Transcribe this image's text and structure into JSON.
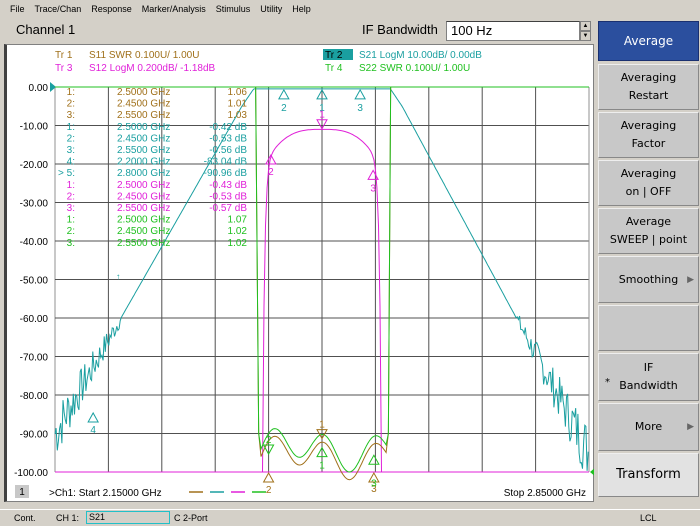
{
  "menu": [
    "File",
    "Trace/Chan",
    "Response",
    "Marker/Analysis",
    "Stimulus",
    "Utility",
    "Help"
  ],
  "channel_title": "Channel 1",
  "if_bandwidth": {
    "label": "IF Bandwidth",
    "value": "100 Hz"
  },
  "softkeys": [
    {
      "label1": "Average",
      "label2": "",
      "active": true
    },
    {
      "label1": "Averaging",
      "label2": "Restart"
    },
    {
      "label1": "Averaging",
      "label2": "Factor"
    },
    {
      "label1": "Averaging",
      "label2": "on | OFF"
    },
    {
      "label1": "Average",
      "label2": "SWEEP | point"
    },
    {
      "label1": "Smoothing",
      "label2": "",
      "submenu": true
    },
    {
      "label1": "",
      "label2": ""
    },
    {
      "label1": "IF",
      "label2": "Bandwidth",
      "star": "*"
    },
    {
      "label1": "More",
      "label2": "",
      "submenu": true
    },
    {
      "label1": "Transform",
      "label2": ""
    }
  ],
  "traces": {
    "tr1": {
      "id": "Tr  1",
      "desc": "S11 SWR 0.100U/  1.00U",
      "color": "#a0701a"
    },
    "tr2": {
      "id": "Tr  2",
      "desc": "S21 LogM 10.00dB/  0.00dB",
      "color": "#1a9fa0",
      "highlight": "#1a9fa0"
    },
    "tr3": {
      "id": "Tr  3",
      "desc": "S12 LogM 0.200dB/  -1.18dB",
      "color": "#e020d8"
    },
    "tr4": {
      "id": "Tr  4",
      "desc": "S22 SWR 0.100U/  1.00U",
      "color": "#20c020"
    }
  },
  "marker_table": [
    {
      "num": "1:",
      "freq": "2.5000 GHz",
      "val": "1.06",
      "trace": "tr1"
    },
    {
      "num": "2:",
      "freq": "2.4500 GHz",
      "val": "1.01",
      "trace": "tr1"
    },
    {
      "num": "3:",
      "freq": "2.5500 GHz",
      "val": "1.03",
      "trace": "tr1"
    },
    {
      "num": "1:",
      "freq": "2.5000 GHz",
      "val": "-0.42 dB",
      "trace": "tr2"
    },
    {
      "num": "2:",
      "freq": "2.4500 GHz",
      "val": "-0.53 dB",
      "trace": "tr2"
    },
    {
      "num": "3:",
      "freq": "2.5500 GHz",
      "val": "-0.56 dB",
      "trace": "tr2"
    },
    {
      "num": "4:",
      "freq": "2.2000 GHz",
      "val": "-83.04 dB",
      "trace": "tr2"
    },
    {
      "num": "> 5:",
      "freq": "2.8000 GHz",
      "val": "-90.96 dB",
      "trace": "tr2"
    },
    {
      "num": "1:",
      "freq": "2.5000 GHz",
      "val": "-0.43 dB",
      "trace": "tr3"
    },
    {
      "num": "2:",
      "freq": "2.4500 GHz",
      "val": "-0.53 dB",
      "trace": "tr3"
    },
    {
      "num": "3:",
      "freq": "2.5500 GHz",
      "val": "-0.57 dB",
      "trace": "tr3"
    },
    {
      "num": "1:",
      "freq": "2.5000 GHz",
      "val": "1.07",
      "trace": "tr4"
    },
    {
      "num": "2:",
      "freq": "2.4500 GHz",
      "val": "1.02",
      "trace": "tr4"
    },
    {
      "num": "3:",
      "freq": "2.5500 GHz",
      "val": "1.02",
      "trace": "tr4"
    }
  ],
  "y_axis": {
    "ticks": [
      "0.00",
      "-10.00",
      "-20.00",
      "-30.00",
      "-40.00",
      "-50.00",
      "-60.00",
      "-70.00",
      "-80.00",
      "-90.00",
      "-100.00"
    ],
    "min": -100,
    "max": 0
  },
  "x_axis": {
    "start_label": ">Ch1: Start  2.15000 GHz",
    "stop_label": "Stop  2.85000 GHz",
    "start_ghz": 2.15,
    "stop_ghz": 2.85
  },
  "channel_badge": "1",
  "marker_labels": {
    "s21": [
      "2",
      "1",
      "3"
    ],
    "s12": [
      "1",
      "2",
      "3"
    ],
    "s11": [
      "1",
      "2",
      "3"
    ],
    "s22": [
      "2",
      "1",
      "3"
    ],
    "m4": "4"
  },
  "statusbar": {
    "mode": "Cont.",
    "channel": "CH 1:",
    "param": "S21",
    "cal": "C  2-Port",
    "lcl": "LCL"
  },
  "grid_color": "#505050"
}
